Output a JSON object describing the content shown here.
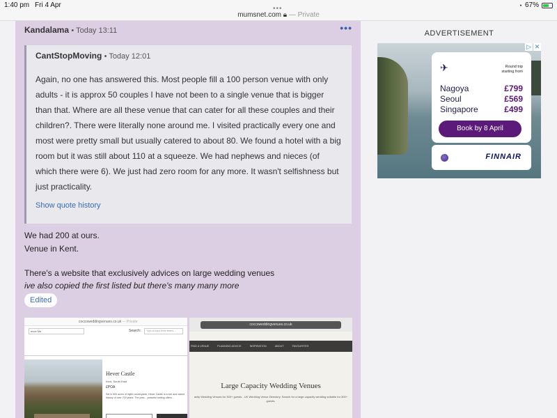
{
  "status": {
    "time": "1:40 pm",
    "date": "Fri 4 Apr",
    "battery": "67%",
    "battery_level": 0.67,
    "wifi_icon": "wifi-icon",
    "battery_icon": "battery-charging-icon"
  },
  "browser": {
    "domain": "mumsnet.com",
    "private_label": "— Private"
  },
  "post": {
    "author": "Kandalama",
    "time": "• Today 13:11",
    "more_icon": "more-horizontal-icon",
    "quote": {
      "author": "CantStopMoving",
      "time": "• Today 12:01",
      "body": "Again, no one has answered this. Most people fill a 100 person venue with only adults - it is approx 50 couples I have not been to a single venue that is bigger than that. Where are all these venue that can cater for all these couples and their children?. There were literally none around me. I visited practically every one and most were pretty small but usually catered to about 80. We found a hotel with a big room but it was still about 110 at a squeeze. We had nephews and nieces (of which there were 6). We just had zero room for any more. It wasn't selfishness but just practicality.",
      "history_link": "Show quote history"
    },
    "line1": "We had 200 at ours.",
    "line2": "Venue in Kent.",
    "line3": "There's a website that exclusively advices on large wedding venues",
    "line4": "ive also copied the first listed but there's many many more",
    "edited": "Edited"
  },
  "screenshot_left": {
    "url": "coccoweddingvenues.co.uk",
    "private": "— Private",
    "filter": "ence Me",
    "search_label": "Search:",
    "search_placeholder": "Type at least three letters...",
    "venue_name": "Hever Castle",
    "venue_location": "Kent, South East",
    "venue_price": "£POA",
    "venue_desc": "Set in 600 acres of idyllic countryside, Hever Castle is a rich and varied history of over 700 years. The pres... peaceful setting offers..."
  },
  "screenshot_right": {
    "url": "coccoweddingvenues.co.uk",
    "nav": [
      "FIND A VENUE",
      "PLANNING ADVICE",
      "INSPIRATION",
      "ABOUT",
      "FAVOURITES"
    ],
    "title": "Large Capacity Wedding Venues",
    "subtitle": "acity Wedding Venues for 300+ guests - UK Wedding Venue Directory. Search for a large capacity wedding suitable for 300+ guests."
  },
  "ad": {
    "label": "ADVERTISEMENT",
    "roundtrip": "Round trip",
    "starting_from": "starting from",
    "routes": [
      {
        "city": "Nagoya",
        "price": "£799"
      },
      {
        "city": "Seoul",
        "price": "£569"
      },
      {
        "city": "Singapore",
        "price": "£499"
      }
    ],
    "cta": "Book by 8 April",
    "brand": "FINNAIR",
    "adchoices_icon": "adchoices-icon",
    "close_icon": "close-icon",
    "plane_icon": "plane-takeoff-icon",
    "oneworld_icon": "oneworld-logo-icon"
  }
}
